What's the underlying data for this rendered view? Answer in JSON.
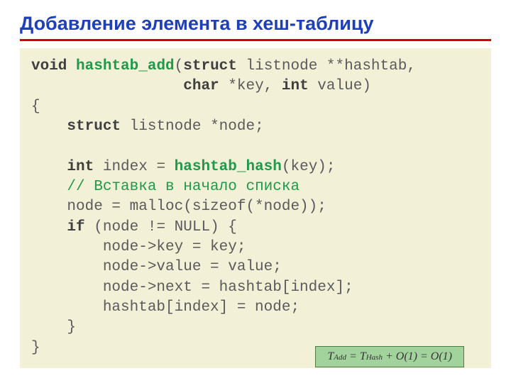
{
  "title": "Добавление элемента в хеш-таблицу",
  "code": {
    "l01a": "void",
    "l01b": " ",
    "l01c": "hashtab_add",
    "l01d": "(",
    "l01e": "struct",
    "l01f": " listnode **hashtab,",
    "l02a": "                 ",
    "l02b": "char",
    "l02c": " *key, ",
    "l02d": "int",
    "l02e": " value)",
    "l03": "{",
    "l04a": "    ",
    "l04b": "struct",
    "l04c": " listnode *node;",
    "l05": "",
    "l06a": "    ",
    "l06b": "int",
    "l06c": " index = ",
    "l06d": "hashtab_hash",
    "l06e": "(key);",
    "l07a": "    ",
    "l07b": "// Вставка в начало списка",
    "l08": "    node = malloc(sizeof(*node));",
    "l09a": "    ",
    "l09b": "if",
    "l09c": " (node != NULL) {",
    "l10": "        node->key = key;",
    "l11": "        node->value = value;",
    "l12": "        node->next = hashtab[index];",
    "l13": "        hashtab[index] = node;",
    "l14": "    }",
    "l15": "}"
  },
  "callout": {
    "T": "T",
    "Add": "Add",
    "eq": " = ",
    "Hash": "Hash",
    "plus": " + ",
    "O1a": "O",
    "paren1": "(1) = ",
    "O1b": "O",
    "paren2": "(1)"
  }
}
